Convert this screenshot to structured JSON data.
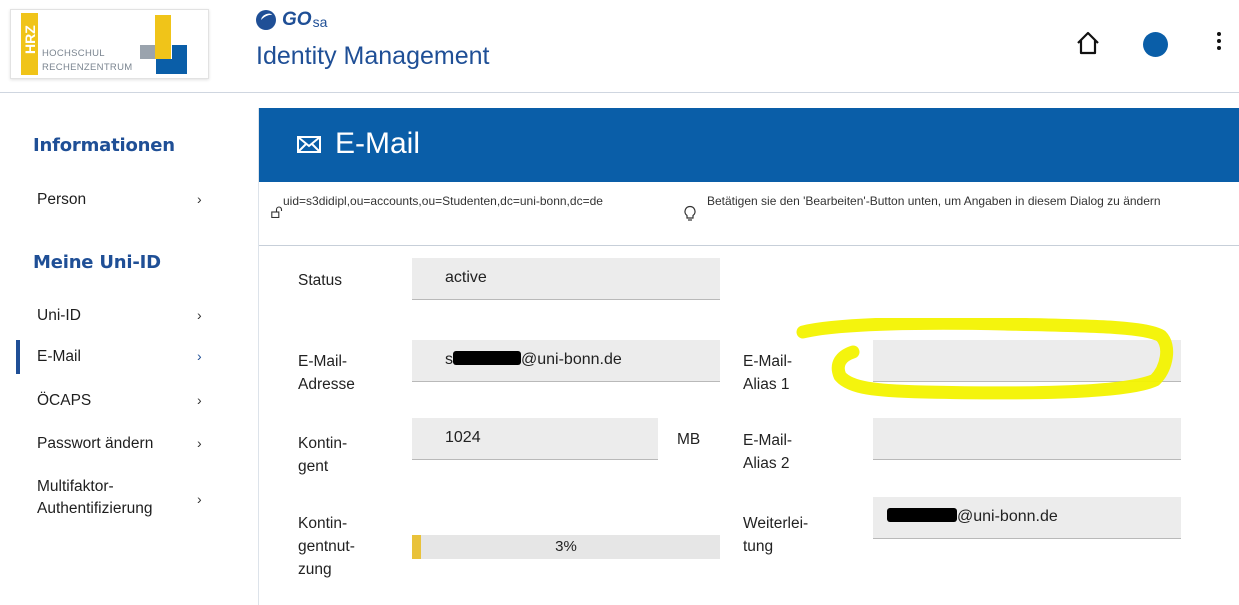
{
  "header": {
    "logo": {
      "badge": "HRZ",
      "line1": "HOCHSCHUL",
      "line2": "RECHENZENTRUM"
    },
    "brand": {
      "go": "GO",
      "sa": "sa"
    },
    "app_title": "Identity Management",
    "icons": [
      "home-icon",
      "user-circle-icon",
      "more-vertical-icon"
    ]
  },
  "sidebar": {
    "section1_title": "Informationen",
    "section1_items": [
      {
        "label": "Person",
        "chevron": "›"
      }
    ],
    "section2_title": "Meine Uni-ID",
    "section2_items": [
      {
        "label": "Uni-ID",
        "chevron": "›"
      },
      {
        "label": "E-Mail",
        "chevron": "›",
        "active": true
      },
      {
        "label": "ÖCAPS",
        "chevron": "›"
      },
      {
        "label": "Passwort ändern",
        "chevron": "›"
      },
      {
        "label": "Multifaktor-Authentifizierung",
        "chevron": "›"
      }
    ]
  },
  "main": {
    "title": "E-Mail",
    "dn": "uid=s3didipl,ou=accounts,ou=Studenten,dc=uni-bonn,dc=de",
    "hint": "Betätigen sie den 'Bearbeiten'-Button unten, um Angaben in diesem Dialog zu ändern",
    "form": {
      "status_label": "Status",
      "status_value": "active",
      "email_label": "E-Mail-Adresse",
      "email_value_prefix": "s",
      "email_value_suffix": "@uni-bonn.de",
      "quota_label": "Kontin-gent",
      "quota_value": "1024",
      "quota_unit": "MB",
      "usage_label": "Kontin-gentnut-zung",
      "usage_percent": 3,
      "usage_text": "3%",
      "alias1_label": "E-Mail-Alias 1",
      "alias1_value": "",
      "alias2_label": "E-Mail-Alias 2",
      "alias2_value": "",
      "forward_label": "Weiterlei-tung",
      "forward_value_suffix": "@uni-bonn.de"
    }
  },
  "colors": {
    "primary": "#0a5ea8",
    "heading": "#1f4f96",
    "accent_yellow": "#f0c419",
    "highlight": "#f3f300",
    "field_bg": "#ececec"
  }
}
